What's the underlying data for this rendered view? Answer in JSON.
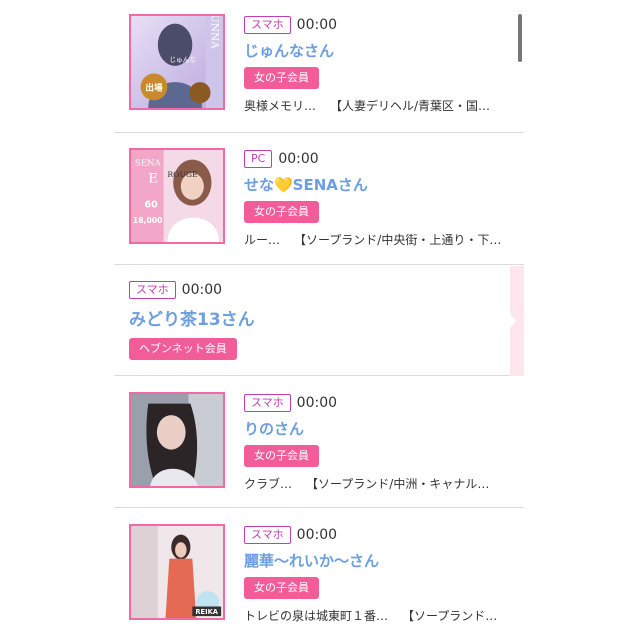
{
  "items": [
    {
      "device": "スマホ",
      "time": "00:00",
      "name": "じゅんなさん",
      "badge": "女の子会員",
      "shop": [
        "奥様メモリ…",
        "【人妻デリヘル/青葉区・国…"
      ],
      "thumb_text": [
        "UNNA",
        "じゅんな",
        "出場"
      ]
    },
    {
      "device": "PC",
      "time": "00:00",
      "name": "せな💛SENAさん",
      "badge": "女の子会員",
      "shop": [
        "ルー…",
        "【ソープランド/中央街・上通り・下…"
      ],
      "thumb_text": [
        "SENA",
        "E",
        "ROUGE",
        "60",
        "18,000"
      ]
    },
    {
      "device": "スマホ",
      "time": "00:00",
      "name": "みどり茶13さん",
      "badge": "ヘブンネット会員",
      "shop": []
    },
    {
      "device": "スマホ",
      "time": "00:00",
      "name": "りのさん",
      "badge": "女の子会員",
      "shop": [
        "クラブ…",
        "【ソープランド/中洲・キャナル…"
      ]
    },
    {
      "device": "スマホ",
      "time": "00:00",
      "name": "麗華〜れいか〜さん",
      "badge": "女の子会員",
      "shop": [
        "トレビの泉は城東町１番…",
        "【ソープランド…"
      ],
      "thumb_text": [
        "REIKA"
      ]
    }
  ],
  "colors": {
    "device_border": "#c23fb3",
    "name": "#6d9fe0",
    "badge_bg": "#f25c98",
    "thumb_border": "#f06aa6"
  }
}
